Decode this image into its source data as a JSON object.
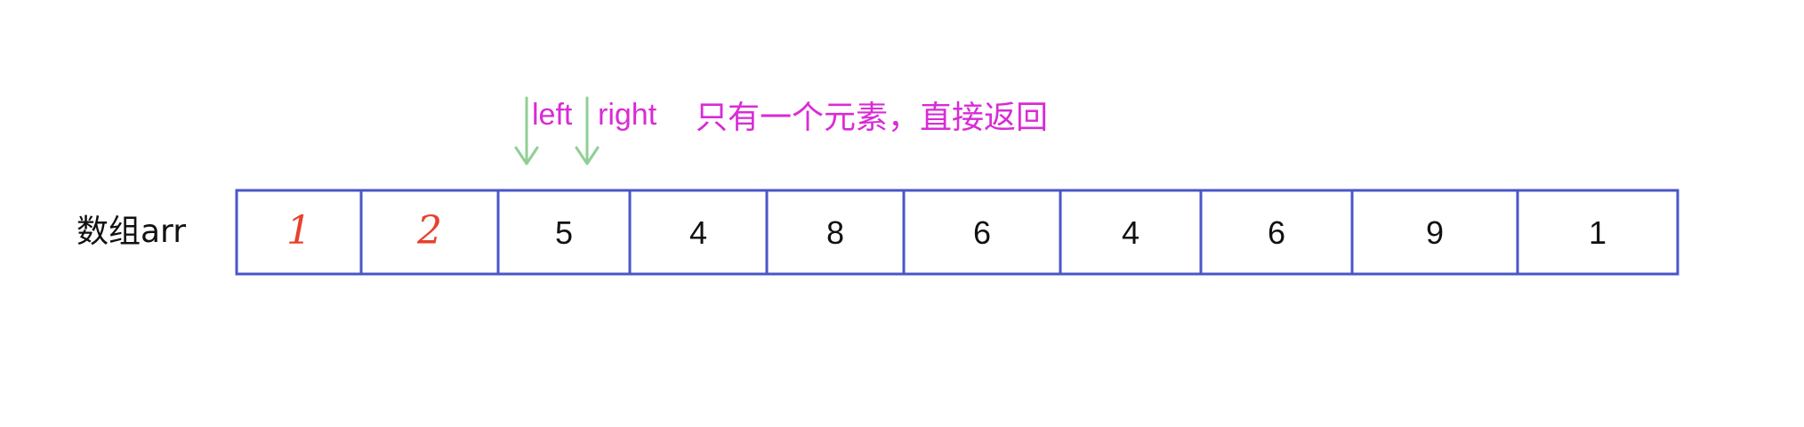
{
  "array": {
    "label": "数组arr",
    "values": [
      "1",
      "2",
      "5",
      "4",
      "8",
      "6",
      "4",
      "6",
      "9",
      "1"
    ],
    "handwritten_indices": [
      0,
      1
    ]
  },
  "pointers": [
    {
      "label": "left",
      "cell_index": 2
    },
    {
      "label": "right",
      "cell_index": 2
    }
  ],
  "note": {
    "text": "只有一个元素，直接返回"
  },
  "colors": {
    "cell_border": "#4a56c8",
    "handwritten": "#e8412c",
    "pointer_arrow": "#8fcf95",
    "pointer_text": "#d92bd6",
    "note_text": "#d92bd6",
    "text": "#111111"
  }
}
